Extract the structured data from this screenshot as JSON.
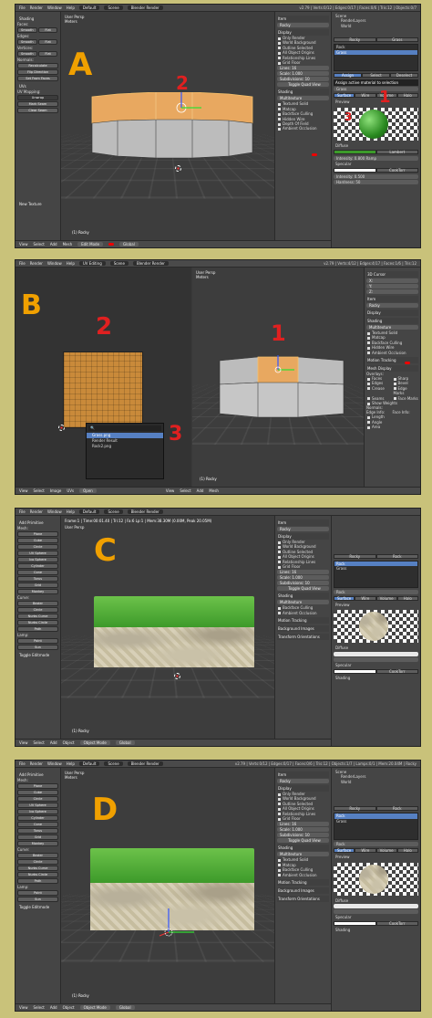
{
  "menu": {
    "file": "File",
    "render": "Render",
    "window": "Window",
    "help": "Help",
    "layout": "Default",
    "scene": "Scene",
    "engine": "Blender Render"
  },
  "panel_a": {
    "letter": "A",
    "stats": "v2.79 | Verts:0/12 | Edges:0/17 | Faces:0/6 | Tris:12 | Objects:0/7",
    "viewport_title": "User Persp",
    "viewport_units": "Meters",
    "object_label": "(1) Rocky",
    "mode": "Edit Mode",
    "orientation": "Global",
    "toolshelf": {
      "header": "Shading",
      "faces": "Faces:",
      "smooth": "Smooth",
      "flat": "Flat",
      "edges": "Edges:",
      "vertices": "Vertices:",
      "normals": "Normals:",
      "recalculate": "Recalculate",
      "flip": "Flip Direction",
      "set_from_faces": "Set From Faces",
      "uvs": "UVs",
      "uv_mapping": "UV Mapping:",
      "unwrap": "Unwrap",
      "mark_seam": "Mark Seam",
      "clear_seam": "Clear Seam",
      "new_texture": "New Texture"
    },
    "npanel": {
      "item": "Item",
      "object_name": "Rocky",
      "display": "Display",
      "only_render": "Only Render",
      "world_bg": "World Background",
      "outline": "Outline Selected",
      "all_origins": "All Object Origins",
      "relationship": "Relationship Lines",
      "grid_floor": "Grid Floor",
      "lines": "Lines:",
      "lines_val": "16",
      "scale": "Scale:",
      "scale_val": "1.000",
      "subdiv": "Subdivisions:",
      "subdiv_val": "10",
      "toggle_quad": "Toggle Quad View",
      "shading": "Shading",
      "multitexture": "Multitexture",
      "textured_solid": "Textured Solid",
      "matcap": "Matcap",
      "backface": "Backface Culling",
      "hidden_wire": "Hidden Wire",
      "depth_of_field": "Depth Of Field",
      "ambient": "Ambient Occlusion"
    },
    "props": {
      "scene": "Scene",
      "render_layers": "RenderLayers",
      "world": "World",
      "rocky": "Rocky",
      "grass": "Grass",
      "rock": "Rock",
      "material_name": "Grass",
      "assign": "Assign",
      "select": "Select",
      "deselect": "Deselect",
      "tooltip": "Assign active material to selection",
      "surface": "Surface",
      "wire": "Wire",
      "volume": "Volume",
      "halo": "Halo",
      "preview": "Preview",
      "diffuse": "Diffuse",
      "lambert": "Lambert",
      "intensity": "Intensity:",
      "intensity_val": "0.800",
      "ramp": "Ramp",
      "specular": "Specular",
      "cooktorr": "CookTorr",
      "spec_intensity": "0.500",
      "hardness": "Hardness:",
      "hardness_val": "50"
    },
    "annotations": {
      "one": "1",
      "two": "2",
      "three": "3"
    }
  },
  "panel_b": {
    "letter": "B",
    "uv_editing": "UV Editing",
    "scene": "Scene",
    "engine": "Blender Render",
    "stats": "v2.79 | Verts:4/12 | Edges:4/17 | Faces:1/6 | Tris:12",
    "viewport_title": "User Persp",
    "viewport_units": "Meters",
    "image_menu": {
      "item1": "Grass.png",
      "item2": "Render Result",
      "item3": "Rock2.png"
    },
    "object_label": "(1) Rocky",
    "bottom": {
      "view": "View",
      "select": "Select",
      "image": "Image",
      "uvs": "UVs",
      "open": "Open",
      "view2": "View"
    },
    "npanel": {
      "cursor_3d": "3D Cursor",
      "x": "X:",
      "y": "Y:",
      "z": "Z:",
      "item": "Item",
      "rocky": "Rocky",
      "display": "Display",
      "shading": "Shading",
      "multitexture": "Multitexture",
      "textured_solid": "Textured Solid",
      "matcap": "Matcap",
      "backface": "Backface Culling",
      "hidden_wire": "Hidden Wire",
      "ambient": "Ambient Occlusion",
      "motion_tracking": "Motion Tracking",
      "mesh_display": "Mesh Display",
      "overlays": "Overlays:",
      "faces": "Faces",
      "sharp": "Sharp",
      "edges": "Edges",
      "bevel": "Bevel",
      "crease": "Crease",
      "edge_marks": "Edge Marks",
      "seams": "Seams",
      "face_marks": "Face Marks",
      "show_weights": "Show Weights",
      "normals": "Normals:",
      "edge_info": "Edge Info:",
      "face_info": "Face Info:",
      "length": "Length",
      "area": "Area",
      "angle": "Angle"
    },
    "annotations": {
      "one": "1",
      "two": "2",
      "three": "3"
    }
  },
  "panel_c": {
    "letter": "C",
    "stats": "Frame:1 | Time:00:01.40 | Tri:12 | Fa:6 Lp:1 | Mem:38.30M (0.00M, Peak 20.05M)",
    "viewport_title": "User Persp",
    "viewport_units": "Meters",
    "object_label": "(1) Rocky",
    "mode": "Object Mode",
    "orientation": "Global",
    "toolshelf": {
      "add_primitive": "Add Primitive",
      "mesh": "Mesh:",
      "plane": "Plane",
      "cube": "Cube",
      "circle": "Circle",
      "uv_sphere": "UV Sphere",
      "ico_sphere": "Ico Sphere",
      "cylinder": "Cylinder",
      "cone": "Cone",
      "torus": "Torus",
      "grid": "Grid",
      "monkey": "Monkey",
      "curve": "Curve:",
      "bezier": "Bezier",
      "circle2": "Circle",
      "nurbs_curve": "Nurbs Curve",
      "nurbs_circle": "Nurbs Circle",
      "path": "Path",
      "lamp": "Lamp:",
      "point": "Point",
      "sun": "Sun",
      "toggle_editmode": "Toggle Editmode"
    },
    "npanel": {
      "item": "Item",
      "rocky": "Rocky",
      "display": "Display",
      "only_render": "Only Render",
      "world_bg": "World Background",
      "outline": "Outline Selected",
      "all_origins": "All Object Origins",
      "relationship": "Relationship Lines",
      "grid_floor": "Grid Floor",
      "lines": "Lines:",
      "lines_val": "16",
      "scale": "Scale:",
      "scale_val": "1.000",
      "subdiv": "Subdivisions:",
      "subdiv_val": "10",
      "toggle_quad": "Toggle Quad View",
      "shading": "Shading",
      "multitexture": "Multitexture",
      "backface": "Backface Culling",
      "ambient": "Ambient Occlusion",
      "motion": "Motion Tracking",
      "background": "Background Images",
      "transform_orient": "Transform Orientations"
    },
    "props": {
      "rocky": "Rocky",
      "rock": "Rock",
      "grass": "Grass",
      "material_name": "Rock",
      "surface": "Surface",
      "wire": "Wire",
      "volume": "Volume",
      "halo": "Halo",
      "preview": "Preview",
      "diffuse": "Diffuse",
      "specular": "Specular",
      "cooktorr": "CookTorr",
      "shading": "Shading"
    }
  },
  "panel_d": {
    "letter": "D",
    "stats": "v2.79 | Verts:0/12 | Edges:0/17 | Faces:0/6 | Tris:12 | Objects:1/7 | Lamps:0/1 | Mem:20.04M | Rocky",
    "viewport_title": "User Persp",
    "viewport_units": "Meters",
    "object_label": "(1) Rocky",
    "mode": "Object Mode",
    "orientation": "Global",
    "props": {
      "scene": "Scene",
      "render_layers": "RenderLayers",
      "world": "World",
      "rocky": "Rocky",
      "rock": "Rock",
      "grass": "Grass",
      "material_name": "Rock",
      "surface": "Surface",
      "wire": "Wire",
      "volume": "Volume",
      "halo": "Halo",
      "preview": "Preview",
      "diffuse": "Diffuse",
      "specular": "Specular",
      "cooktorr": "CookTorr",
      "shading": "Shading"
    }
  },
  "bottom_common": {
    "view": "View",
    "select": "Select",
    "add": "Add",
    "object": "Object",
    "mesh": "Mesh"
  },
  "colors": {
    "background": "#c9c27a",
    "panel": "#393939",
    "selected_face": "#e8a860",
    "unselected_face": "#bcbcbc",
    "handwriting_red": "#e02020",
    "handwriting_orange": "#f0a000",
    "selection_blue": "#5680c2"
  }
}
